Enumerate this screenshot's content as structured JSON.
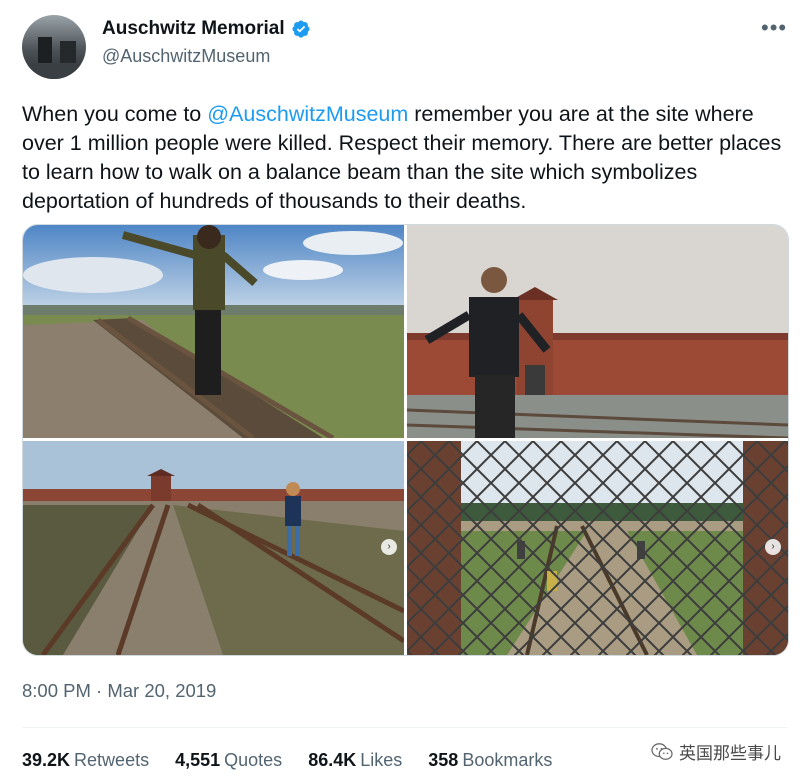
{
  "author": {
    "display_name": "Auschwitz Memorial",
    "handle": "@AuschwitzMuseum",
    "verified": true
  },
  "more_icon": "more-horizontal-icon",
  "tweet": {
    "text_before": "When you come to ",
    "mention": "@AuschwitzMuseum",
    "text_after": " remember you are at the  site where over 1 million people were killed. Respect their memory. There are better places to learn how to walk on a balance beam than the site which symbolizes deportation of hundreds of thousands to their deaths."
  },
  "timestamp": "8:00 PM · Mar 20, 2019",
  "stats": {
    "retweets": {
      "count": "39.2K",
      "label": "Retweets"
    },
    "quotes": {
      "count": "4,551",
      "label": "Quotes"
    },
    "likes": {
      "count": "86.4K",
      "label": "Likes"
    },
    "bookmarks": {
      "count": "358",
      "label": "Bookmarks"
    }
  },
  "watermark": "英国那些事儿",
  "colors": {
    "link": "#1d9bf0",
    "secondary": "#536471",
    "primary": "#0f1419"
  }
}
